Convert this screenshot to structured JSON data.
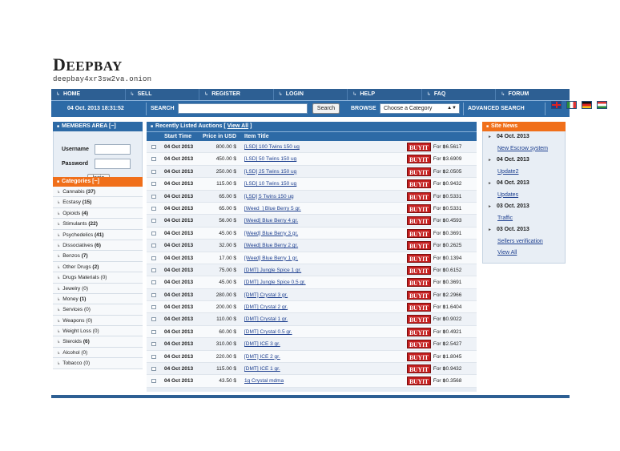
{
  "header": {
    "logo_first": "D",
    "logo_rest": "EEPBAY",
    "onion": "deepbay4xr3sw2va.onion"
  },
  "nav": [
    {
      "label": "HOME"
    },
    {
      "label": "SELL"
    },
    {
      "label": "REGISTER"
    },
    {
      "label": "LOGIN"
    },
    {
      "label": "HELP"
    },
    {
      "label": "FAQ"
    },
    {
      "label": "FORUM"
    }
  ],
  "searchbar": {
    "datetime": "04 Oct. 2013 18:31:52",
    "search_label": "SEARCH",
    "search_value": "",
    "search_button": "Search",
    "browse_label": "BROWSE",
    "category_selected": "Choose a Category",
    "advanced": "ADVANCED SEARCH"
  },
  "members": {
    "title": "MEMBERS AREA [−]",
    "username_label": "Username",
    "password_label": "Password",
    "login_button": "login"
  },
  "categories": {
    "title": "Categories [−]",
    "items": [
      {
        "name": "Cannabis",
        "count": "(37)",
        "bold": true
      },
      {
        "name": "Ecstasy",
        "count": "(15)",
        "bold": true
      },
      {
        "name": "Opioids",
        "count": "(4)",
        "bold": true
      },
      {
        "name": "Stimulants",
        "count": "(22)",
        "bold": true
      },
      {
        "name": "Psychedelics",
        "count": "(41)",
        "bold": true
      },
      {
        "name": "Dissociatives",
        "count": "(6)",
        "bold": true
      },
      {
        "name": "Benzos",
        "count": "(7)",
        "bold": true
      },
      {
        "name": "Other Drugs",
        "count": "(2)",
        "bold": true
      },
      {
        "name": "Drugs Materials",
        "count": "(0)",
        "bold": false
      },
      {
        "name": "Jewelry",
        "count": "(0)",
        "bold": false
      },
      {
        "name": "Money",
        "count": "(1)",
        "bold": true
      },
      {
        "name": "Services",
        "count": "(0)",
        "bold": false
      },
      {
        "name": "Weapons",
        "count": "(0)",
        "bold": false
      },
      {
        "name": "Weight Loss",
        "count": "(0)",
        "bold": false
      },
      {
        "name": "Steroids",
        "count": "(6)",
        "bold": true
      },
      {
        "name": "Alcohol",
        "count": "(0)",
        "bold": false
      },
      {
        "name": "Tobacco",
        "count": "(0)",
        "bold": false
      }
    ]
  },
  "auctions": {
    "title": "Recently Listed Auctions [",
    "view_all": "View All",
    "title_end": "]",
    "columns": [
      "Start Time",
      "Price in USD",
      "Item Title"
    ],
    "buyit": "BUYIT",
    "rows": [
      {
        "time": "04 Oct 2013",
        "usd": "800.00 $",
        "title": "[LSD] 100 Twins 150 ug",
        "btc": "For ฿6.5617"
      },
      {
        "time": "04 Oct 2013",
        "usd": "450.00 $",
        "title": "[LSD] 50 Twins 150 ug",
        "btc": "For ฿3.6909"
      },
      {
        "time": "04 Oct 2013",
        "usd": "250.00 $",
        "title": "[LSD] 25 Twins 150 ug",
        "btc": "For ฿2.0505"
      },
      {
        "time": "04 Oct 2013",
        "usd": "115.00 $",
        "title": "[LSD] 10 Twins 150 ug",
        "btc": "For ฿0.9432"
      },
      {
        "time": "04 Oct 2013",
        "usd": "65.00 $",
        "title": "[LSD] 5 Twins 150 ug",
        "btc": "For ฿0.5331"
      },
      {
        "time": "04 Oct 2013",
        "usd": "65.00 $",
        "title": "[Weed_] Blue Berry 5 gr.",
        "btc": "For ฿0.5331"
      },
      {
        "time": "04 Oct 2013",
        "usd": "56.00 $",
        "title": "[Weed] Blue Berry 4 gr.",
        "btc": "For ฿0.4593"
      },
      {
        "time": "04 Oct 2013",
        "usd": "45.00 $",
        "title": "[Weed] Blue Berry 3 gr.",
        "btc": "For ฿0.3691"
      },
      {
        "time": "04 Oct 2013",
        "usd": "32.00 $",
        "title": "[Weed] Blue Berry 2 gr.",
        "btc": "For ฿0.2625"
      },
      {
        "time": "04 Oct 2013",
        "usd": "17.00 $",
        "title": "[Weed] Blue Berry 1 gr.",
        "btc": "For ฿0.1394"
      },
      {
        "time": "04 Oct 2013",
        "usd": "75.00 $",
        "title": "[DMT] Jungle Spice 1 gr.",
        "btc": "For ฿0.6152"
      },
      {
        "time": "04 Oct 2013",
        "usd": "45.00 $",
        "title": "[DMT] Jungle Spice 0.5 gr.",
        "btc": "For ฿0.3691"
      },
      {
        "time": "04 Oct 2013",
        "usd": "280.00 $",
        "title": "[DMT] Crystal 3 gr.",
        "btc": "For ฿2.2966"
      },
      {
        "time": "04 Oct 2013",
        "usd": "200.00 $",
        "title": "[DMT] Crystal 2 gr.",
        "btc": "For ฿1.6404"
      },
      {
        "time": "04 Oct 2013",
        "usd": "110.00 $",
        "title": "[DMT] Crystal 1 gr.",
        "btc": "For ฿0.9022"
      },
      {
        "time": "04 Oct 2013",
        "usd": "60.00 $",
        "title": "[DMT] Crystal 0.5 gr.",
        "btc": "For ฿0.4921"
      },
      {
        "time": "04 Oct 2013",
        "usd": "310.00 $",
        "title": "[DMT] ICE 3 gr.",
        "btc": "For ฿2.5427"
      },
      {
        "time": "04 Oct 2013",
        "usd": "220.00 $",
        "title": "[DMT] ICE 2 gr.",
        "btc": "For ฿1.8045"
      },
      {
        "time": "04 Oct 2013",
        "usd": "115.00 $",
        "title": "[DMT] ICE 1 gr.",
        "btc": "For ฿0.9432"
      },
      {
        "time": "04 Oct 2013",
        "usd": "43.50 $",
        "title": "1g Crystal mdma",
        "btc": "For ฿0.3568"
      }
    ]
  },
  "news": {
    "title": "Site News",
    "items": [
      {
        "date": "04 Oct. 2013",
        "link": "New Escrow system"
      },
      {
        "date": "04 Oct. 2013",
        "link": "Update2"
      },
      {
        "date": "04 Oct. 2013",
        "link": "Updates"
      },
      {
        "date": "03 Oct. 2013",
        "link": "Traffic"
      },
      {
        "date": "03 Oct. 2013",
        "link": "Sellers verification"
      }
    ],
    "view_all": "View All"
  },
  "colors": {
    "nav_blue": "#2d5f93",
    "bar_blue": "#2d6aa6",
    "orange": "#f06f1a",
    "buyit_red": "#c41e1e"
  }
}
